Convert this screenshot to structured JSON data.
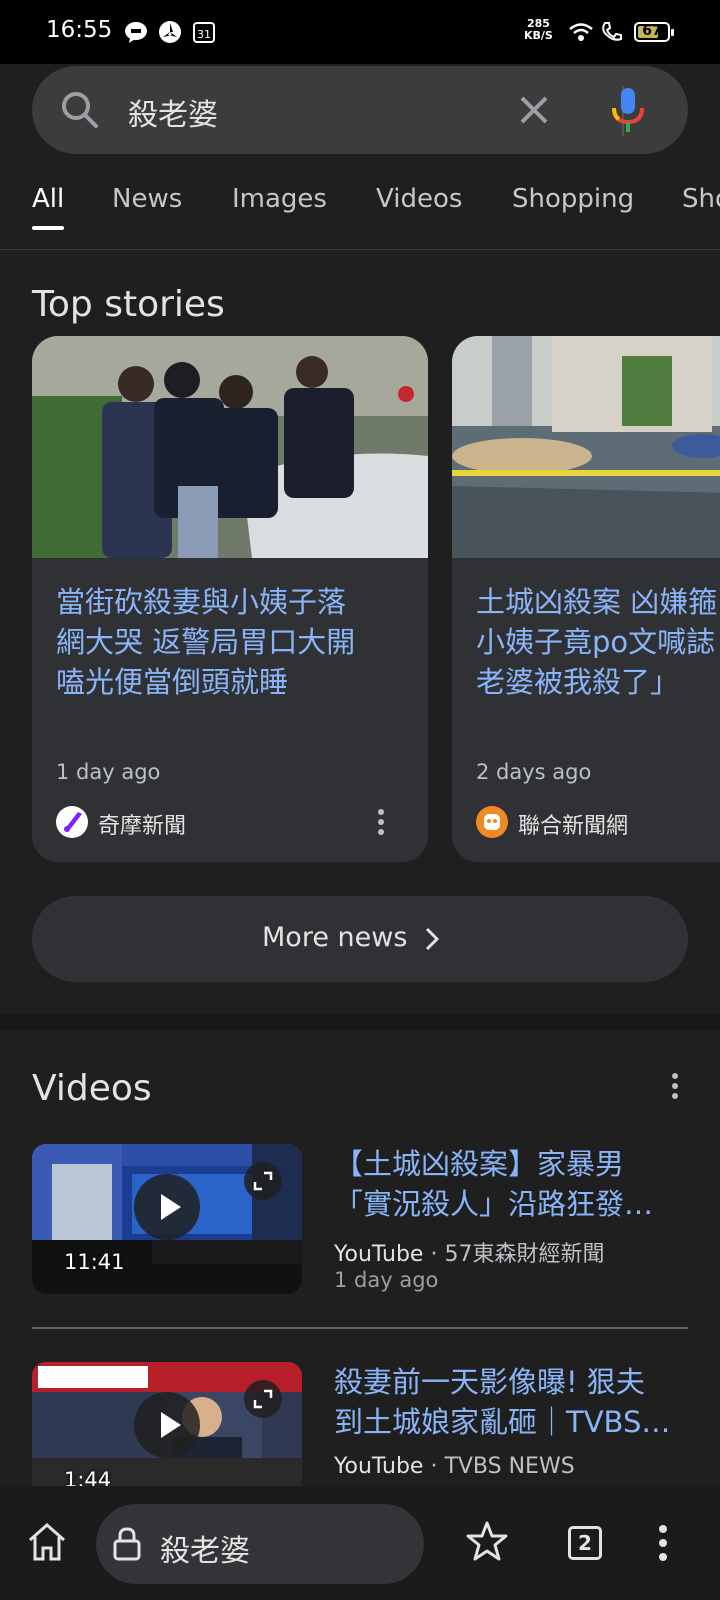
{
  "status_bar": {
    "time": "16:55",
    "icons": [
      "line-icon",
      "app-icon",
      "calendar-icon"
    ],
    "net_speed_value": "285",
    "net_speed_unit": "KB/S",
    "battery": "67"
  },
  "search": {
    "query": "殺老婆"
  },
  "tabs": [
    "All",
    "News",
    "Images",
    "Videos",
    "Shopping",
    "Sho"
  ],
  "top_stories": {
    "title": "Top stories",
    "cards": [
      {
        "headline_lines": [
          "當街砍殺妻與小姨子落",
          "網大哭 返警局胃口大開",
          "嗑光便當倒頭就睡"
        ],
        "age": "1 day ago",
        "source": "奇摩新聞"
      },
      {
        "headline_lines": [
          "土城凶殺案 凶嫌箍",
          "小姨子竟po文喊誌",
          "老婆被我殺了」"
        ],
        "age": "2 days ago",
        "source": "聯合新聞網"
      }
    ],
    "more_news": "More news"
  },
  "videos": {
    "title": "Videos",
    "items": [
      {
        "title_line1": "【土城凶殺案】家暴男",
        "title_line2": "「實況殺人」沿路狂發…",
        "platform": "YouTube",
        "channel": " · 57東森財經新聞",
        "age": "1 day ago",
        "duration": "11:41"
      },
      {
        "title_line1": "殺妻前一天影像曝! 狠夫",
        "title_line2": "到土城娘家亂砸｜TVBS…",
        "platform": "YouTube",
        "channel": " · TVBS NEWS",
        "duration": "1:44"
      }
    ]
  },
  "bottom_bar": {
    "address": "殺老婆",
    "tab_count": "2"
  },
  "colors": {
    "background": "#1f1f1f",
    "link": "#8ab4f8",
    "surface": "#303134"
  }
}
